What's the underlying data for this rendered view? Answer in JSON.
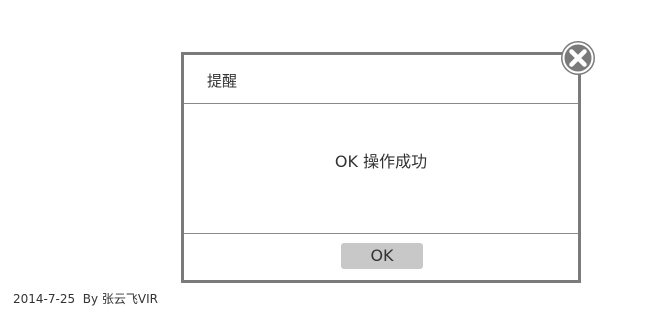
{
  "dialog": {
    "title": "提醒",
    "message": "OK 操作成功",
    "ok_label": "OK",
    "close_icon": "close-circle-icon"
  },
  "footer": {
    "credit": "2014-7-25  By 张云飞VIR"
  },
  "colors": {
    "border": "#7b7b7b",
    "divider": "#8a8a8a",
    "button_bg": "#c8c8c8",
    "close_icon_bg": "#7a7a7a",
    "text": "#333333"
  }
}
